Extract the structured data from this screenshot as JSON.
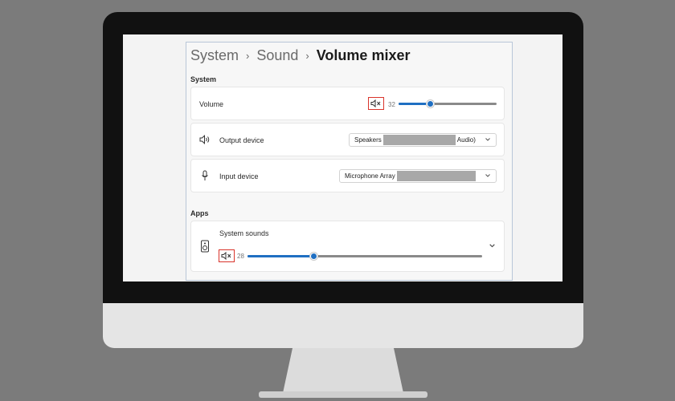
{
  "breadcrumb": {
    "items": [
      "System",
      "Sound"
    ],
    "current": "Volume mixer"
  },
  "system_section": {
    "label": "System",
    "volume": {
      "label": "Volume",
      "value": "32",
      "level": 0.32,
      "muted_icon": "speaker-muted-icon"
    },
    "output_device": {
      "label": "Output device",
      "selected_prefix": "Speakers",
      "selected_suffix": "Audio)",
      "icon": "speaker-icon"
    },
    "input_device": {
      "label": "Input device",
      "selected_prefix": "Microphone Array",
      "icon": "microphone-icon"
    }
  },
  "apps_section": {
    "label": "Apps",
    "system_sounds": {
      "label": "System sounds",
      "value": "28",
      "level": 0.28,
      "icon": "system-sounds-icon",
      "muted_icon": "speaker-muted-icon"
    }
  },
  "colors": {
    "accent": "#1f6fc2",
    "highlight_box": "#d9342b",
    "background": "#7b7b7b"
  }
}
